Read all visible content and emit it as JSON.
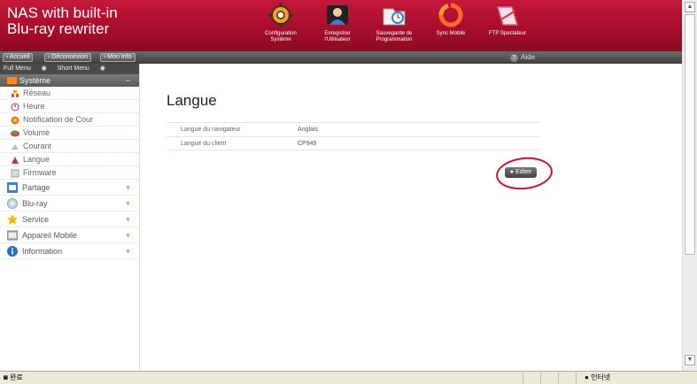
{
  "header": {
    "brand_line1": "NAS with built-in",
    "brand_line2": "Blu-ray rewriter",
    "nav": [
      {
        "icon": "gear-icon",
        "line1": "Configuration",
        "line2": "Système"
      },
      {
        "icon": "user-icon",
        "line1": "Enregistrer",
        "line2": "l'Utilisateur"
      },
      {
        "icon": "schedule-icon",
        "line1": "Sauvegarde de",
        "line2": "Programmation"
      },
      {
        "icon": "sync-icon",
        "line1": "Sync Mobile",
        "line2": ""
      },
      {
        "icon": "ftp-icon",
        "line1": "FTP Spectateur",
        "line2": ""
      }
    ]
  },
  "toolbar": {
    "home": "Accueil",
    "logout": "Déconnexion",
    "myinfo": "Mon Info",
    "help": "Aide"
  },
  "sidebar": {
    "full_menu": "Full Menu",
    "short_menu": "Short Menu",
    "active_category": "Système",
    "sub_items": [
      "Réseau",
      "Heure",
      "Notification de Cour",
      "Volume",
      "Courant",
      "Langue",
      "Firmware"
    ],
    "categories": [
      "Partage",
      "Blu-ray",
      "Service",
      "Appareil Mobile",
      "Information"
    ]
  },
  "main": {
    "title": "Langue",
    "rows": [
      {
        "label": "Langue du navigateur",
        "value": "Anglais"
      },
      {
        "label": "Langue du client",
        "value": "CP949"
      }
    ],
    "edit_label": "Editer"
  },
  "statusbar": {
    "left": "완료",
    "right": "인터넷"
  },
  "colors": {
    "header_red": "#b01232",
    "annotation_circle": "#d0102a"
  }
}
